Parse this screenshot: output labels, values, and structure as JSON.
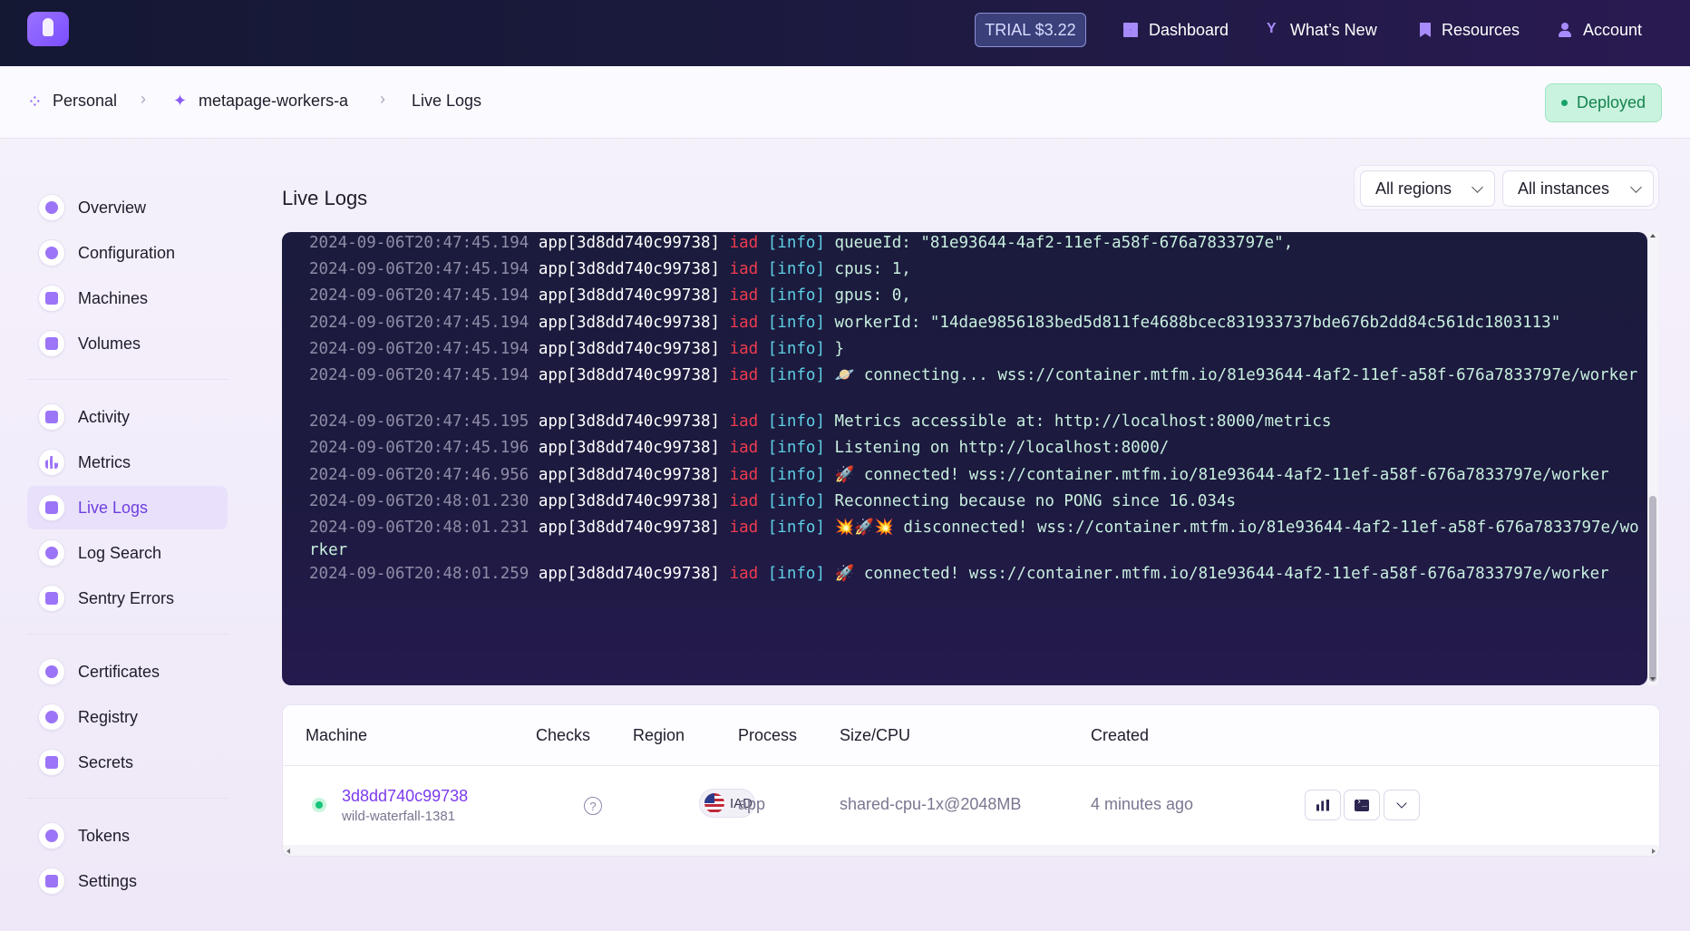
{
  "topbar": {
    "trial_label": "TRIAL $3.22",
    "nav": [
      {
        "label": "Dashboard",
        "icon": "dashboard-icon"
      },
      {
        "label": "What’s New",
        "icon": "whats-new-icon"
      },
      {
        "label": "Resources",
        "icon": "bookmark-icon"
      },
      {
        "label": "Account",
        "icon": "user-icon"
      }
    ]
  },
  "breadcrumb": {
    "items": [
      "Personal",
      "metapage-workers-a",
      "Live Logs"
    ],
    "separator": "›"
  },
  "status": {
    "label": "Deployed",
    "color": "#16a36a"
  },
  "sidebar": {
    "items": [
      {
        "label": "Overview",
        "icon": "overview-icon"
      },
      {
        "label": "Configuration",
        "icon": "gear-icon"
      },
      {
        "label": "Machines",
        "icon": "cpu-icon"
      },
      {
        "label": "Volumes",
        "icon": "volume-icon"
      },
      {
        "label": "Activity",
        "icon": "activity-icon"
      },
      {
        "label": "Metrics",
        "icon": "bar-chart-icon"
      },
      {
        "label": "Live Logs",
        "icon": "pulse-icon",
        "active": true
      },
      {
        "label": "Log Search",
        "icon": "search-icon"
      },
      {
        "label": "Sentry Errors",
        "icon": "sentry-icon"
      },
      {
        "label": "Certificates",
        "icon": "certificate-icon"
      },
      {
        "label": "Registry",
        "icon": "share-icon"
      },
      {
        "label": "Secrets",
        "icon": "lock-icon"
      },
      {
        "label": "Tokens",
        "icon": "token-icon"
      },
      {
        "label": "Settings",
        "icon": "settings-icon"
      }
    ]
  },
  "main": {
    "title": "Live Logs",
    "filters": {
      "region": "All regions",
      "instance": "All instances"
    }
  },
  "logs": [
    {
      "ts": "2024-09-06T20:47:45.194",
      "app": "app[3d8dd740c99738]",
      "region": "iad",
      "level": "[info]",
      "msg": "queueId: \"81e93644-4af2-11ef-a58f-676a7833797e\","
    },
    {
      "ts": "2024-09-06T20:47:45.194",
      "app": "app[3d8dd740c99738]",
      "region": "iad",
      "level": "[info]",
      "msg": "cpus: 1,"
    },
    {
      "ts": "2024-09-06T20:47:45.194",
      "app": "app[3d8dd740c99738]",
      "region": "iad",
      "level": "[info]",
      "msg": "gpus: 0,"
    },
    {
      "ts": "2024-09-06T20:47:45.194",
      "app": "app[3d8dd740c99738]",
      "region": "iad",
      "level": "[info]",
      "msg": "workerId: \"14dae9856183bed5d811fe4688bcec831933737bde676b2dd84c561dc1803113\""
    },
    {
      "ts": "2024-09-06T20:47:45.194",
      "app": "app[3d8dd740c99738]",
      "region": "iad",
      "level": "[info]",
      "msg": "}"
    },
    {
      "ts": "2024-09-06T20:47:45.194",
      "app": "app[3d8dd740c99738]",
      "region": "iad",
      "level": "[info]",
      "msg": "🪐 connecting... wss://container.mtfm.io/81e93644-4af2-11ef-a58f-676a7833797e/worker"
    },
    {
      "ts": "2024-09-06T20:47:45.195",
      "app": "app[3d8dd740c99738]",
      "region": "iad",
      "level": "[info]",
      "msg": "Metrics accessible at: http://localhost:8000/metrics"
    },
    {
      "ts": "2024-09-06T20:47:45.196",
      "app": "app[3d8dd740c99738]",
      "region": "iad",
      "level": "[info]",
      "msg": "Listening on http://localhost:8000/"
    },
    {
      "ts": "2024-09-06T20:47:46.956",
      "app": "app[3d8dd740c99738]",
      "region": "iad",
      "level": "[info]",
      "msg": "🚀 connected! wss://container.mtfm.io/81e93644-4af2-11ef-a58f-676a7833797e/worker"
    },
    {
      "ts": "2024-09-06T20:48:01.230",
      "app": "app[3d8dd740c99738]",
      "region": "iad",
      "level": "[info]",
      "msg": "Reconnecting because no PONG since 16.034s"
    },
    {
      "ts": "2024-09-06T20:48:01.231",
      "app": "app[3d8dd740c99738]",
      "region": "iad",
      "level": "[info]",
      "msg": "💥🚀💥 disconnected! wss://container.mtfm.io/81e93644-4af2-11ef-a58f-676a7833797e/worker"
    },
    {
      "ts": "2024-09-06T20:48:01.259",
      "app": "app[3d8dd740c99738]",
      "region": "iad",
      "level": "[info]",
      "msg": "🚀 connected! wss://container.mtfm.io/81e93644-4af2-11ef-a58f-676a7833797e/worker"
    }
  ],
  "table": {
    "headers": [
      "Machine",
      "Checks",
      "Region",
      "Process",
      "Size/CPU",
      "Created"
    ],
    "row": {
      "id": "3d8dd740c99738",
      "name": "wild-waterfall-1381",
      "checks": "?",
      "region": "IAD",
      "process": "app",
      "size": "shared-cpu-1x@2048MB",
      "created": "4 minutes ago"
    }
  },
  "colors": {
    "accent": "#7c3aed",
    "log_region": "#ef3b4f",
    "log_level": "#5fd0e5",
    "status_green": "#16c47a"
  }
}
